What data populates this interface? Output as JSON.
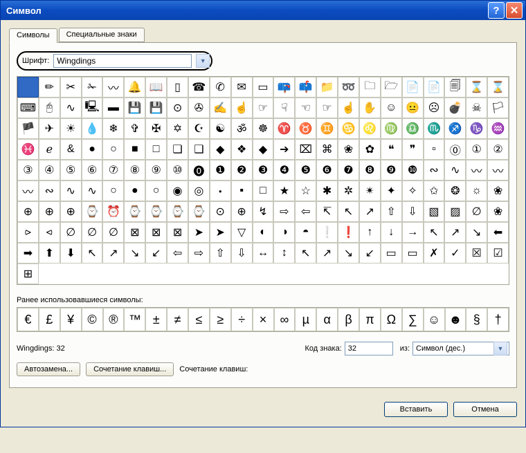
{
  "title": "Символ",
  "tabs": [
    "Символы",
    "Специальные знаки"
  ],
  "active_tab": 0,
  "font": {
    "label": "Шрифт:",
    "value": "Wingdings"
  },
  "symbols": [
    " ",
    "✏",
    "✂",
    "✁",
    "〰",
    "🔔",
    "📖",
    "▯",
    "☎",
    "✆",
    "✉",
    "▭",
    "📪",
    "📫",
    "📁",
    "➿",
    "🗀",
    "🗁",
    "📄",
    "📄",
    "🗐",
    "⌛",
    "⌛",
    "⌨",
    "🖰",
    "∿",
    "🖳",
    "▬",
    "💾",
    "💾",
    "⊙",
    "✇",
    "✍",
    "☝",
    "☞",
    "☟",
    "☜",
    "☞",
    "☝",
    "✋",
    "☺",
    "😐",
    "☹",
    "💣",
    "☠",
    "🏳",
    "🏴",
    "✈",
    "☀",
    "💧",
    "❄",
    "✞",
    "✠",
    "✡",
    "☪",
    "☯",
    "ॐ",
    "☸",
    "♈",
    "♉",
    "♊",
    "♋",
    "♌",
    "♍",
    "♎",
    "♏",
    "♐",
    "♑",
    "♒",
    "♓",
    "ℯ",
    "&",
    "●",
    "○",
    "■",
    "□",
    "❏",
    "❑",
    "◆",
    "❖",
    "◆",
    "➔",
    "⌧",
    "⌘",
    "❀",
    "✿",
    "❝",
    "❞",
    "▫",
    "⓪",
    "①",
    "②",
    "③",
    "④",
    "⑤",
    "⑥",
    "⑦",
    "⑧",
    "⑨",
    "⑩",
    "⓿",
    "❶",
    "❷",
    "❸",
    "❹",
    "❺",
    "❻",
    "❼",
    "❽",
    "❾",
    "❿",
    "∾",
    "∿",
    "〰",
    "〰",
    "〰",
    "∾",
    "∿",
    "∿",
    "○",
    "●",
    "○",
    "◉",
    "◎",
    "・",
    "▪",
    "□",
    "★",
    "☆",
    "✱",
    "✲",
    "✴",
    "✦",
    "✧",
    "✩",
    "❂",
    "☼",
    "❀",
    "⊕",
    "⊕",
    "⊕",
    "⌚",
    "⏰",
    "⌚",
    "⌚",
    "⌚",
    "⌚",
    "⊙",
    "⊕",
    "↯",
    "⇨",
    "⇦",
    "↸",
    "↖",
    "↗",
    "⇧",
    "⇩",
    "▧",
    "▨",
    "∅",
    "❀",
    "⪧",
    "⪦",
    "∅",
    "∅",
    "∅",
    "⊠",
    "⊠",
    "⊠",
    "➤",
    "➤",
    "▽",
    "◐",
    "◑",
    "◓",
    "❕",
    "❗",
    "↑",
    "↓",
    "→",
    "↖",
    "↗",
    "↘",
    "⬅",
    "➡",
    "⬆",
    "⬇",
    "↖",
    "↗",
    "↘",
    "↙",
    "⇦",
    "⇨",
    "⇧",
    "⇩",
    "↔",
    "↕",
    "↖",
    "↗",
    "↘",
    "↙",
    "▭",
    "▭",
    "✗",
    "✓",
    "☒",
    "☑",
    "⊞"
  ],
  "recent_label": "Ранее использовавшиеся символы:",
  "recent": [
    "€",
    "£",
    "¥",
    "©",
    "®",
    "™",
    "±",
    "≠",
    "≤",
    "≥",
    "÷",
    "×",
    "∞",
    "µ",
    "α",
    "β",
    "π",
    "Ω",
    "∑",
    "☺",
    "☻",
    "§",
    "†"
  ],
  "status": "Wingdings: 32",
  "code": {
    "label": "Код знака:",
    "value": "32"
  },
  "from": {
    "label": "из:",
    "value": "Символ (дес.)"
  },
  "buttons": {
    "autocorrect": "Автозамена...",
    "shortcut": "Сочетание клавиш...",
    "shortcut_label": "Сочетание клавиш:"
  },
  "footer": {
    "insert": "Вставить",
    "cancel": "Отмена"
  }
}
